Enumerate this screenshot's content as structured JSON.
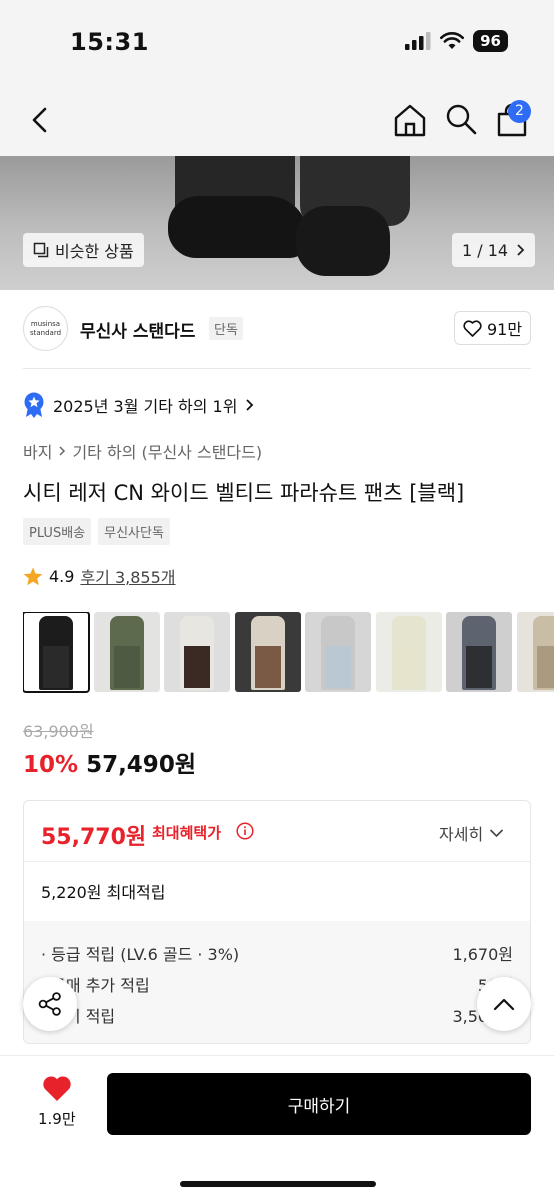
{
  "status_bar": {
    "time": "15:31",
    "battery": "96"
  },
  "nav": {
    "cart_count": "2"
  },
  "hero": {
    "similar_label": "비슷한 상품",
    "page_counter": "1 / 14"
  },
  "brand": {
    "logo_line1": "musinsa",
    "logo_line2": "standard",
    "name": "무신사 스탠다드",
    "tag": "단독",
    "like_count": "91만"
  },
  "ranking": {
    "text": "2025년 3월 기타 하의 1위"
  },
  "breadcrumb": {
    "level1": "바지",
    "level2": "기타 하의 (무신사 스탠다드)"
  },
  "product": {
    "title": "시티 레저 CN 와이드 벨티드 파라슈트 팬츠 [블랙]",
    "tags": [
      "PLUS배송",
      "무신사단독"
    ],
    "rating": "4.9",
    "review_label": "후기 3,855개"
  },
  "thumbnails": [
    {
      "bg": "#ffffff",
      "top": "#1c1c1c",
      "legs": "#2a2a2a",
      "selected": true
    },
    {
      "bg": "#e3e3e1",
      "top": "#5e6a4d",
      "legs": "#4f5a42",
      "selected": false
    },
    {
      "bg": "#dedede",
      "top": "#e8e6e0",
      "legs": "#3b2a24",
      "selected": false
    },
    {
      "bg": "#3a3a3a",
      "top": "#d9d2c4",
      "legs": "#7a5a45",
      "selected": false
    },
    {
      "bg": "#d6d6d6",
      "top": "#c8c8c8",
      "legs": "#b9c8d3",
      "selected": false
    },
    {
      "bg": "#ecece6",
      "top": "#e5e4cf",
      "legs": "#e6e4cc",
      "selected": false
    },
    {
      "bg": "#cfcfcf",
      "top": "#5d6470",
      "legs": "#2d2f33",
      "selected": false
    },
    {
      "bg": "#e6e3dd",
      "top": "#c9bda5",
      "legs": "#a99a80",
      "selected": false
    },
    {
      "bg": "#efefef",
      "top": "#e2e2e2",
      "legs": "#8a5a55",
      "selected": false
    }
  ],
  "price": {
    "original": "63,900원",
    "discount": "10%",
    "sale": "57,490원"
  },
  "benefit": {
    "max_price": "55,770원",
    "max_label": "최대혜택가",
    "detail_label": "자세히",
    "max_points": "5,220원 최대적립",
    "rows": [
      {
        "label": "· 등급 적립 (LV.6 골드 · 3%)",
        "value": "1,670원"
      },
      {
        "label": "· 구매 추가 적립",
        "value": "50원"
      },
      {
        "label": "· 후기 적립",
        "value": "3,500원"
      }
    ]
  },
  "bottom": {
    "like_count": "1.9만",
    "buy_label": "구매하기"
  },
  "colors": {
    "accent_red": "#e8222b",
    "badge_blue": "#2e6cf6"
  }
}
